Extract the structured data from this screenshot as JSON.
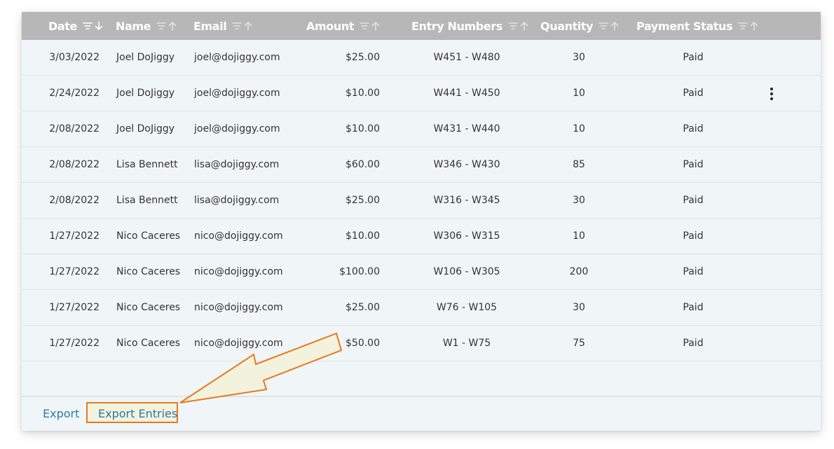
{
  "table": {
    "columns": [
      {
        "label": "Date",
        "sort": "down"
      },
      {
        "label": "Name",
        "sort": "up"
      },
      {
        "label": "Email",
        "sort": "up"
      },
      {
        "label": "Amount",
        "sort": "up"
      },
      {
        "label": "Entry Numbers",
        "sort": "up"
      },
      {
        "label": "Quantity",
        "sort": "up"
      },
      {
        "label": "Payment Status",
        "sort": "up"
      }
    ],
    "rows": [
      {
        "date": "3/03/2022",
        "name": "Joel DoJiggy",
        "email": "joel@dojiggy.com",
        "amount": "$25.00",
        "entries": "W451 - W480",
        "quantity": "30",
        "status": "Paid"
      },
      {
        "date": "2/24/2022",
        "name": "Joel DoJiggy",
        "email": "joel@dojiggy.com",
        "amount": "$10.00",
        "entries": "W441 - W450",
        "quantity": "10",
        "status": "Paid"
      },
      {
        "date": "2/08/2022",
        "name": "Joel DoJiggy",
        "email": "joel@dojiggy.com",
        "amount": "$10.00",
        "entries": "W431 - W440",
        "quantity": "10",
        "status": "Paid"
      },
      {
        "date": "2/08/2022",
        "name": "Lisa Bennett",
        "email": "lisa@dojiggy.com",
        "amount": "$60.00",
        "entries": "W346 - W430",
        "quantity": "85",
        "status": "Paid"
      },
      {
        "date": "2/08/2022",
        "name": "Lisa Bennett",
        "email": "lisa@dojiggy.com",
        "amount": "$25.00",
        "entries": "W316 - W345",
        "quantity": "30",
        "status": "Paid"
      },
      {
        "date": "1/27/2022",
        "name": "Nico Caceres",
        "email": "nico@dojiggy.com",
        "amount": "$10.00",
        "entries": "W306 - W315",
        "quantity": "10",
        "status": "Paid"
      },
      {
        "date": "1/27/2022",
        "name": "Nico Caceres",
        "email": "nico@dojiggy.com",
        "amount": "$100.00",
        "entries": "W106 - W305",
        "quantity": "200",
        "status": "Paid"
      },
      {
        "date": "1/27/2022",
        "name": "Nico Caceres",
        "email": "nico@dojiggy.com",
        "amount": "$25.00",
        "entries": "W76 - W105",
        "quantity": "30",
        "status": "Paid"
      },
      {
        "date": "1/27/2022",
        "name": "Nico Caceres",
        "email": "nico@dojiggy.com",
        "amount": "$50.00",
        "entries": "W1 - W75",
        "quantity": "75",
        "status": "Paid"
      }
    ],
    "row_menu_icon": "more-vertical-icon"
  },
  "footer": {
    "export_label": "Export",
    "export_entries_label": "Export Entries"
  },
  "colors": {
    "header_bg": "#b7b7b7",
    "table_bg": "#f0f6f8",
    "link": "#2f77a8",
    "callout_accent": "#e8781f",
    "callout_fill": "#f3f3dd"
  }
}
